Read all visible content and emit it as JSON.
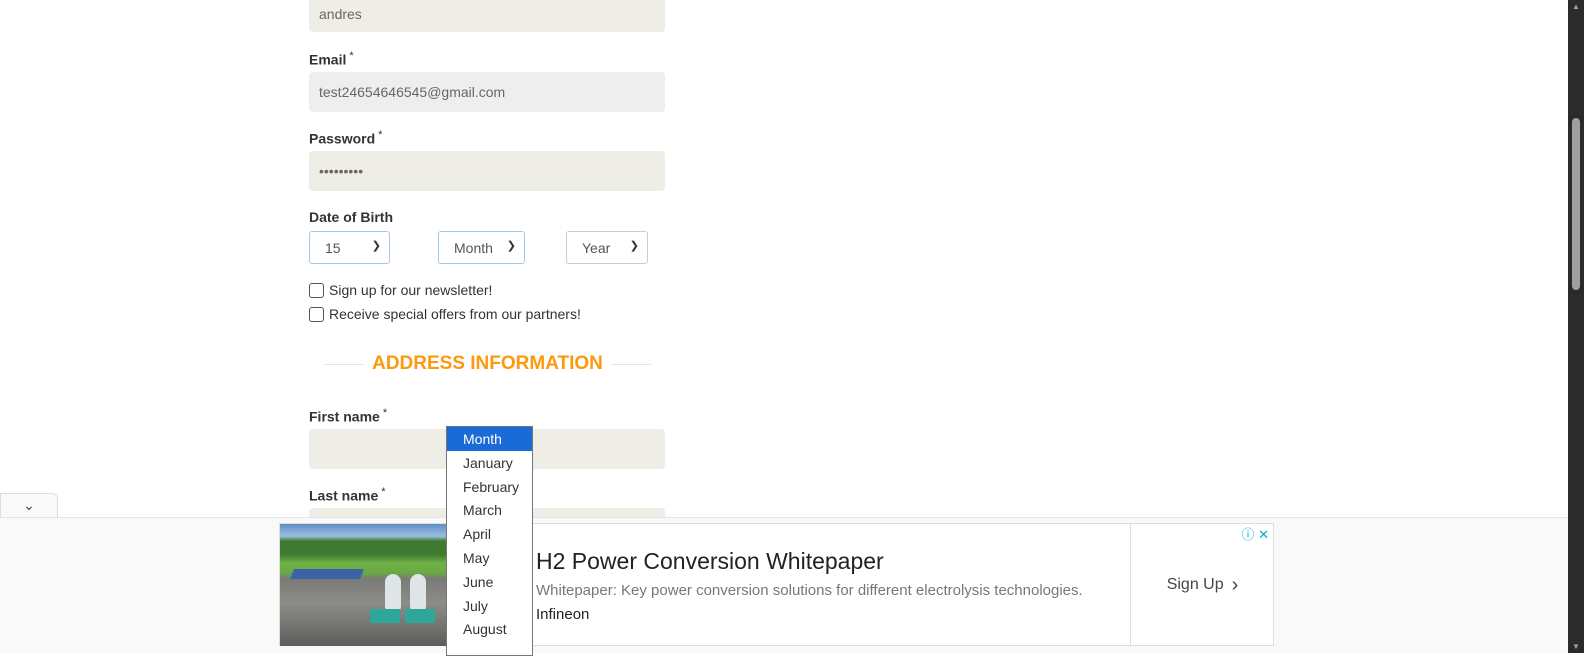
{
  "form": {
    "name_value": "andres",
    "email_label": "Email",
    "email_value": "test24654646545@gmail.com",
    "password_label": "Password",
    "password_value": "•••••••••",
    "required_mark": "*",
    "dob_label": "Date of Birth",
    "day_value": "15",
    "month_value": "Month",
    "year_value": "Year",
    "newsletter_label": "Sign up for our newsletter!",
    "offers_label": "Receive special offers from our partners!",
    "address_title": "ADDRESS INFORMATION",
    "first_name_label": "First name",
    "last_name_label": "Last name"
  },
  "month_dropdown": {
    "options": [
      "Month",
      "January",
      "February",
      "March",
      "April",
      "May",
      "June",
      "July",
      "August"
    ],
    "selected": "Month"
  },
  "ad": {
    "title": "H2 Power Conversion Whitepaper",
    "description": "Whitepaper: Key power conversion solutions for different electrolysis technologies.",
    "brand": "Infineon",
    "cta": "Sign Up",
    "icons": [
      "info-icon",
      "close-icon"
    ]
  },
  "colors": {
    "accent": "#fe980f",
    "dropdown_highlight": "#1a6ad7",
    "input_bg": "#eeede6"
  }
}
